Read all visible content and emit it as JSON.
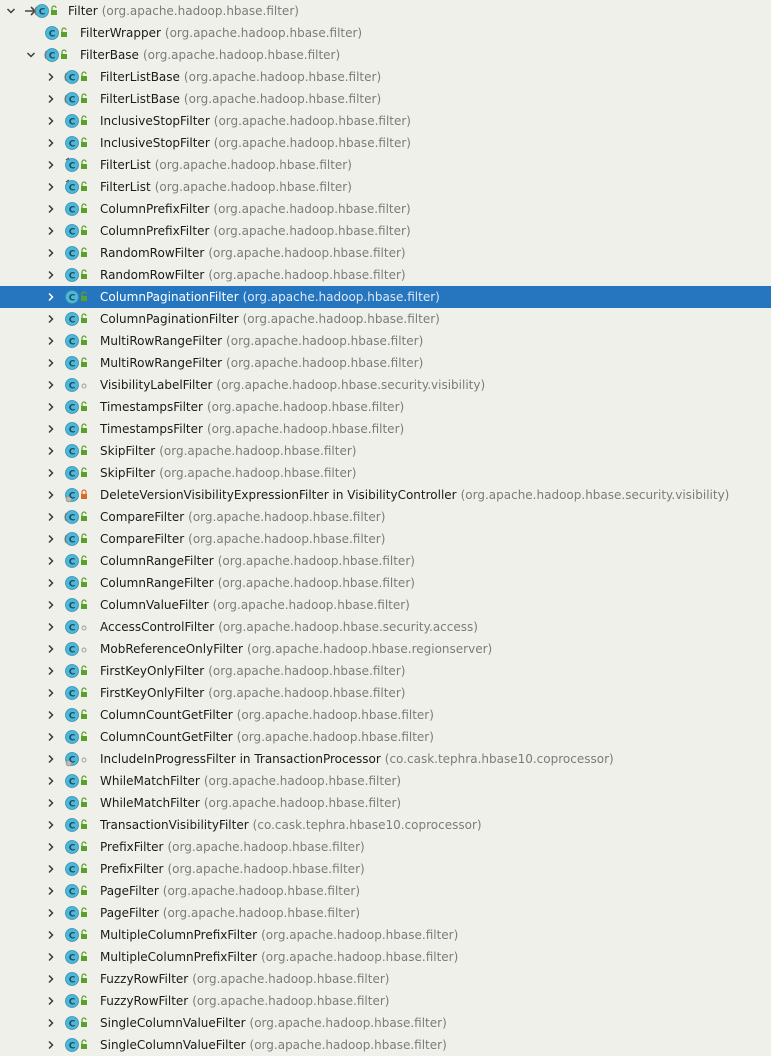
{
  "tree": {
    "rows": [
      {
        "name": "Filter",
        "pkg": "(org.apache.hadoop.hbase.filter)",
        "level": 0,
        "expanded": true,
        "icon": "abstract-class-icon",
        "access": "public",
        "arrowmark": true
      },
      {
        "name": "FilterWrapper",
        "pkg": "(org.apache.hadoop.hbase.filter)",
        "level": 1,
        "leaf": true,
        "icon": "class-icon",
        "access": "public"
      },
      {
        "name": "FilterBase",
        "pkg": "(org.apache.hadoop.hbase.filter)",
        "level": 1,
        "expanded": true,
        "icon": "abstract-class-icon",
        "access": "public"
      },
      {
        "name": "FilterListBase",
        "pkg": "(org.apache.hadoop.hbase.filter)",
        "level": 2,
        "icon": "abstract-class-icon",
        "access": "public"
      },
      {
        "name": "FilterListBase",
        "pkg": "(org.apache.hadoop.hbase.filter)",
        "level": 2,
        "icon": "abstract-class-icon",
        "access": "public"
      },
      {
        "name": "InclusiveStopFilter",
        "pkg": "(org.apache.hadoop.hbase.filter)",
        "level": 2,
        "icon": "class-icon",
        "access": "public"
      },
      {
        "name": "InclusiveStopFilter",
        "pkg": "(org.apache.hadoop.hbase.filter)",
        "level": 2,
        "icon": "class-icon",
        "access": "public"
      },
      {
        "name": "FilterList",
        "pkg": "(org.apache.hadoop.hbase.filter)",
        "level": 2,
        "icon": "final-class-icon",
        "access": "public"
      },
      {
        "name": "FilterList",
        "pkg": "(org.apache.hadoop.hbase.filter)",
        "level": 2,
        "icon": "final-class-icon",
        "access": "public"
      },
      {
        "name": "ColumnPrefixFilter",
        "pkg": "(org.apache.hadoop.hbase.filter)",
        "level": 2,
        "icon": "class-icon",
        "access": "public"
      },
      {
        "name": "ColumnPrefixFilter",
        "pkg": "(org.apache.hadoop.hbase.filter)",
        "level": 2,
        "icon": "class-icon",
        "access": "public"
      },
      {
        "name": "RandomRowFilter",
        "pkg": "(org.apache.hadoop.hbase.filter)",
        "level": 2,
        "icon": "class-icon",
        "access": "public"
      },
      {
        "name": "RandomRowFilter",
        "pkg": "(org.apache.hadoop.hbase.filter)",
        "level": 2,
        "icon": "class-icon",
        "access": "public"
      },
      {
        "name": "ColumnPaginationFilter",
        "pkg": "(org.apache.hadoop.hbase.filter)",
        "level": 2,
        "icon": "class-icon",
        "access": "public",
        "selected": true
      },
      {
        "name": "ColumnPaginationFilter",
        "pkg": "(org.apache.hadoop.hbase.filter)",
        "level": 2,
        "icon": "class-icon",
        "access": "public"
      },
      {
        "name": "MultiRowRangeFilter",
        "pkg": "(org.apache.hadoop.hbase.filter)",
        "level": 2,
        "icon": "class-icon",
        "access": "public"
      },
      {
        "name": "MultiRowRangeFilter",
        "pkg": "(org.apache.hadoop.hbase.filter)",
        "level": 2,
        "icon": "class-icon",
        "access": "public"
      },
      {
        "name": "VisibilityLabelFilter",
        "pkg": "(org.apache.hadoop.hbase.security.visibility)",
        "level": 2,
        "icon": "class-icon",
        "access": "package"
      },
      {
        "name": "TimestampsFilter",
        "pkg": "(org.apache.hadoop.hbase.filter)",
        "level": 2,
        "icon": "class-icon",
        "access": "public"
      },
      {
        "name": "TimestampsFilter",
        "pkg": "(org.apache.hadoop.hbase.filter)",
        "level": 2,
        "icon": "class-icon",
        "access": "public"
      },
      {
        "name": "SkipFilter",
        "pkg": "(org.apache.hadoop.hbase.filter)",
        "level": 2,
        "icon": "class-icon",
        "access": "public"
      },
      {
        "name": "SkipFilter",
        "pkg": "(org.apache.hadoop.hbase.filter)",
        "level": 2,
        "icon": "class-icon",
        "access": "public"
      },
      {
        "name": "DeleteVersionVisibilityExpressionFilter in VisibilityController",
        "pkg": "(org.apache.hadoop.hbase.security.visibility)",
        "level": 2,
        "icon": "inner-class-icon",
        "access": "private"
      },
      {
        "name": "CompareFilter",
        "pkg": "(org.apache.hadoop.hbase.filter)",
        "level": 2,
        "icon": "abstract-class-icon",
        "access": "public"
      },
      {
        "name": "CompareFilter",
        "pkg": "(org.apache.hadoop.hbase.filter)",
        "level": 2,
        "icon": "abstract-class-icon",
        "access": "public"
      },
      {
        "name": "ColumnRangeFilter",
        "pkg": "(org.apache.hadoop.hbase.filter)",
        "level": 2,
        "icon": "class-icon",
        "access": "public"
      },
      {
        "name": "ColumnRangeFilter",
        "pkg": "(org.apache.hadoop.hbase.filter)",
        "level": 2,
        "icon": "class-icon",
        "access": "public"
      },
      {
        "name": "ColumnValueFilter",
        "pkg": "(org.apache.hadoop.hbase.filter)",
        "level": 2,
        "icon": "class-icon",
        "access": "public"
      },
      {
        "name": "AccessControlFilter",
        "pkg": "(org.apache.hadoop.hbase.security.access)",
        "level": 2,
        "icon": "class-icon",
        "access": "package"
      },
      {
        "name": "MobReferenceOnlyFilter",
        "pkg": "(org.apache.hadoop.hbase.regionserver)",
        "level": 2,
        "icon": "class-icon",
        "access": "package"
      },
      {
        "name": "FirstKeyOnlyFilter",
        "pkg": "(org.apache.hadoop.hbase.filter)",
        "level": 2,
        "icon": "class-icon",
        "access": "public"
      },
      {
        "name": "FirstKeyOnlyFilter",
        "pkg": "(org.apache.hadoop.hbase.filter)",
        "level": 2,
        "icon": "class-icon",
        "access": "public"
      },
      {
        "name": "ColumnCountGetFilter",
        "pkg": "(org.apache.hadoop.hbase.filter)",
        "level": 2,
        "icon": "class-icon",
        "access": "public"
      },
      {
        "name": "ColumnCountGetFilter",
        "pkg": "(org.apache.hadoop.hbase.filter)",
        "level": 2,
        "icon": "class-icon",
        "access": "public"
      },
      {
        "name": "IncludeInProgressFilter in TransactionProcessor",
        "pkg": "(co.cask.tephra.hbase10.coprocessor)",
        "level": 2,
        "icon": "inner-class-icon",
        "access": "package"
      },
      {
        "name": "WhileMatchFilter",
        "pkg": "(org.apache.hadoop.hbase.filter)",
        "level": 2,
        "icon": "class-icon",
        "access": "public"
      },
      {
        "name": "WhileMatchFilter",
        "pkg": "(org.apache.hadoop.hbase.filter)",
        "level": 2,
        "icon": "class-icon",
        "access": "public"
      },
      {
        "name": "TransactionVisibilityFilter",
        "pkg": "(co.cask.tephra.hbase10.coprocessor)",
        "level": 2,
        "icon": "class-icon",
        "access": "public"
      },
      {
        "name": "PrefixFilter",
        "pkg": "(org.apache.hadoop.hbase.filter)",
        "level": 2,
        "icon": "class-icon",
        "access": "public"
      },
      {
        "name": "PrefixFilter",
        "pkg": "(org.apache.hadoop.hbase.filter)",
        "level": 2,
        "icon": "class-icon",
        "access": "public"
      },
      {
        "name": "PageFilter",
        "pkg": "(org.apache.hadoop.hbase.filter)",
        "level": 2,
        "icon": "class-icon",
        "access": "public"
      },
      {
        "name": "PageFilter",
        "pkg": "(org.apache.hadoop.hbase.filter)",
        "level": 2,
        "icon": "class-icon",
        "access": "public"
      },
      {
        "name": "MultipleColumnPrefixFilter",
        "pkg": "(org.apache.hadoop.hbase.filter)",
        "level": 2,
        "icon": "class-icon",
        "access": "public"
      },
      {
        "name": "MultipleColumnPrefixFilter",
        "pkg": "(org.apache.hadoop.hbase.filter)",
        "level": 2,
        "icon": "class-icon",
        "access": "public"
      },
      {
        "name": "FuzzyRowFilter",
        "pkg": "(org.apache.hadoop.hbase.filter)",
        "level": 2,
        "icon": "class-icon",
        "access": "public"
      },
      {
        "name": "FuzzyRowFilter",
        "pkg": "(org.apache.hadoop.hbase.filter)",
        "level": 2,
        "icon": "class-icon",
        "access": "public"
      },
      {
        "name": "SingleColumnValueFilter",
        "pkg": "(org.apache.hadoop.hbase.filter)",
        "level": 2,
        "icon": "class-icon",
        "access": "public"
      },
      {
        "name": "SingleColumnValueFilter",
        "pkg": "(org.apache.hadoop.hbase.filter)",
        "level": 2,
        "icon": "class-icon",
        "access": "public"
      }
    ]
  },
  "colors": {
    "background": "#f0f0eb",
    "selection": "#2675bf",
    "class_icon_fill": "#4fb8d6",
    "public_access": "#5aa12a",
    "private_access": "#d86a2a",
    "package_text": "#7b7b7b"
  }
}
